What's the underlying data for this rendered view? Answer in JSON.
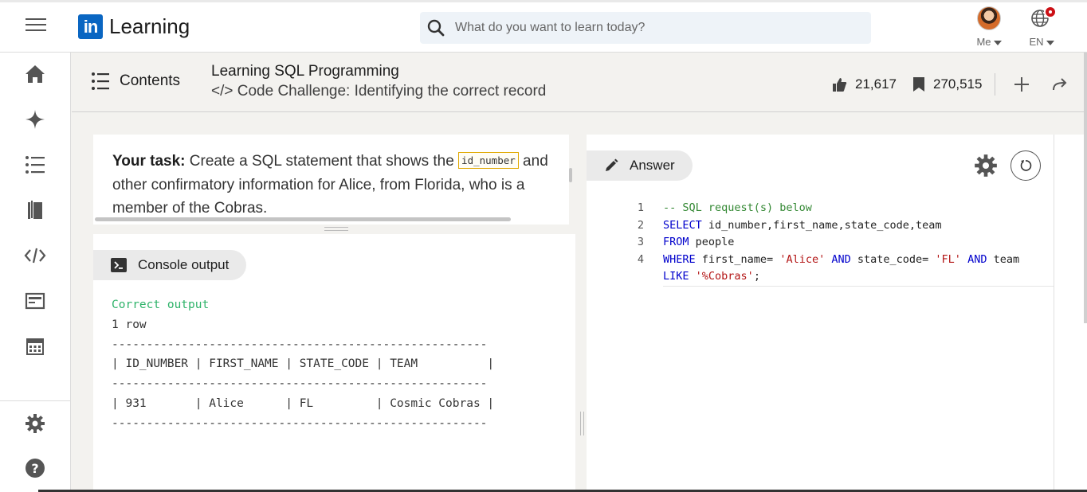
{
  "topbar": {
    "logo_mark": "in",
    "logo_text": "Learning",
    "search_placeholder": "What do you want to learn today?",
    "me_label": "Me",
    "lang_label": "EN"
  },
  "sidebar": {
    "items": [
      "home-icon",
      "sparkle-icon",
      "list-icon",
      "library-icon",
      "code-icon",
      "certificate-icon",
      "calendar-icon",
      "settings-icon",
      "help-icon"
    ]
  },
  "header": {
    "contents_label": "Contents",
    "course_title": "Learning SQL Programming",
    "video_title": "</> Code Challenge: Identifying the correct record",
    "likes": "21,617",
    "saves": "270,515"
  },
  "task": {
    "label": "Your task:",
    "text_before": " Create a SQL statement that shows the ",
    "code": "id_number",
    "text_after": " and other confirmatory information for Alice, from Florida, who is a member of the Cobras."
  },
  "console": {
    "tab_label": "Console output",
    "status": "Correct output",
    "row_count": "1 row",
    "separator": "------------------------------------------------------",
    "header_row": "| ID_NUMBER | FIRST_NAME | STATE_CODE | TEAM          |",
    "data_row": "| 931       | Alice      | FL         | Cosmic Cobras |"
  },
  "answer": {
    "tab_label": "Answer",
    "line_numbers": [
      "1",
      "2",
      "3",
      "4"
    ],
    "code": {
      "l1": "-- SQL request(s) below",
      "l2_kw": "SELECT",
      "l2_rest": " id_number,first_name,state_code,team",
      "l3_kw": "FROM",
      "l3_rest": " people",
      "l4_kw1": "WHERE",
      "l4_a": " first_name= ",
      "l4_s1": "'Alice'",
      "l4_sp1": " ",
      "l4_kw2": "AND",
      "l4_b": " state_code= ",
      "l4_s2": "'FL'",
      "l4_sp2": " ",
      "l4_kw3": "AND",
      "l4_c": " team",
      "l5_kw": "LIKE",
      "l5_sp": " ",
      "l5_s": "'%Cobras'",
      "l5_end": ";"
    }
  },
  "colors": {
    "brand": "#0a66c2",
    "success": "#2fb36a",
    "notification": "#cc1016"
  }
}
